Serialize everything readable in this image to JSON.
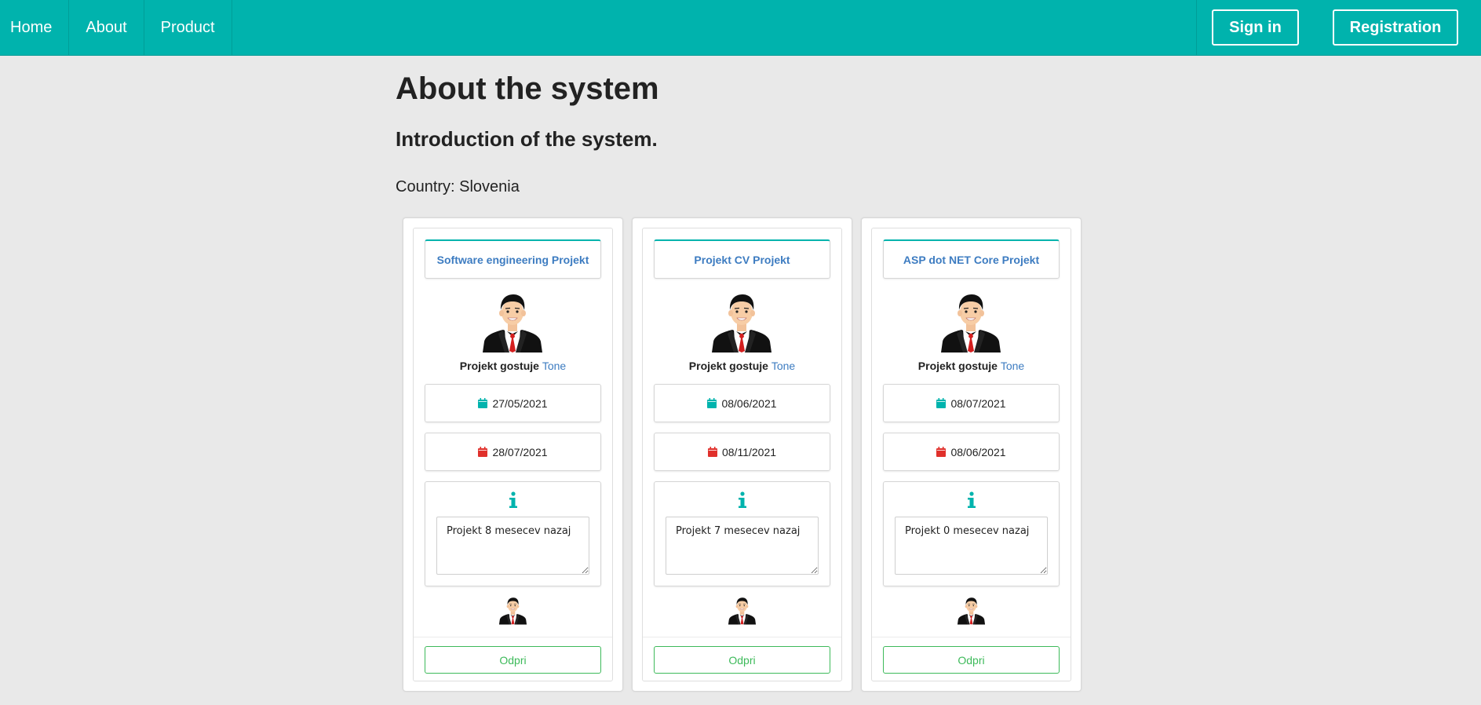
{
  "nav": {
    "items": [
      {
        "label": "Home"
      },
      {
        "label": "About"
      },
      {
        "label": "Product"
      }
    ],
    "signin_label": "Sign in",
    "register_label": "Registration"
  },
  "page": {
    "title": "About the system",
    "subtitle": "Introduction of the system.",
    "country": "Country: Slovenia"
  },
  "cards": [
    {
      "title": "Software engineering Projekt",
      "host_prefix": "Projekt gostuje ",
      "host_name": "Tone",
      "start_date": "27/05/2021",
      "end_date": "28/07/2021",
      "description": "Projekt 8 mesecev nazaj",
      "open_label": "Odpri"
    },
    {
      "title": "Projekt CV Projekt",
      "host_prefix": "Projekt gostuje ",
      "host_name": "Tone",
      "start_date": "08/06/2021",
      "end_date": "08/11/2021",
      "description": "Projekt 7 mesecev nazaj",
      "open_label": "Odpri"
    },
    {
      "title": "ASP dot NET Core Projekt",
      "host_prefix": "Projekt gostuje ",
      "host_name": "Tone",
      "start_date": "08/07/2021",
      "end_date": "08/06/2021",
      "description": "Projekt 0 mesecev nazaj",
      "open_label": "Odpri"
    }
  ],
  "colors": {
    "brand": "#00b3ad",
    "link": "#3d7cc1",
    "start_date_icon": "#00b3ad",
    "end_date_icon": "#e0302b",
    "open_button": "#3dba5a"
  },
  "icons": {
    "start": "calendar-icon",
    "end": "calendar-icon",
    "info": "info-icon",
    "avatar": "businessman-avatar-icon"
  }
}
